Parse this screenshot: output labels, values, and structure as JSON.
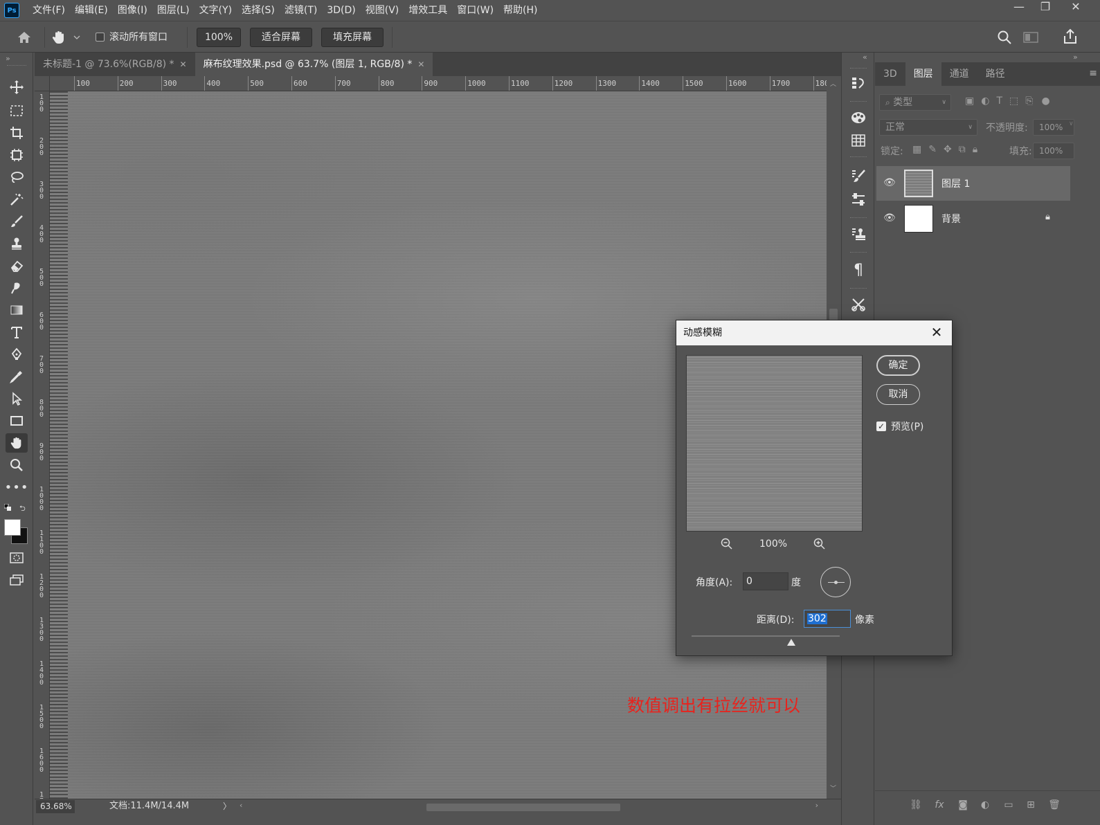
{
  "app": {
    "logo": "Ps"
  },
  "menu": [
    "文件(F)",
    "编辑(E)",
    "图像(I)",
    "图层(L)",
    "文字(Y)",
    "选择(S)",
    "滤镜(T)",
    "3D(D)",
    "视图(V)",
    "增效工具",
    "窗口(W)",
    "帮助(H)"
  ],
  "window_controls": {
    "minimize": "—",
    "restore": "❐",
    "close": "✕"
  },
  "options": {
    "scroll_all_label": "滚动所有窗口",
    "scroll_all_checked": false,
    "zoom_value": "100%",
    "fit_screen": "适合屏幕",
    "fill_screen": "填充屏幕"
  },
  "tabs": [
    {
      "label": "未标题-1 @ 73.6%(RGB/8) *",
      "active": false
    },
    {
      "label": "麻布纹理效果.psd @ 63.7% (图层 1, RGB/8) *",
      "active": true
    }
  ],
  "ruler_h": [
    "100",
    "200",
    "300",
    "400",
    "500",
    "600",
    "700",
    "800",
    "900",
    "1000",
    "1100",
    "1200",
    "1300",
    "1400",
    "1500",
    "1600",
    "1700",
    "180"
  ],
  "ruler_v": [
    "100",
    "200",
    "300",
    "400",
    "500",
    "600",
    "700",
    "800",
    "900",
    "1000",
    "1100",
    "1200",
    "1300",
    "1400",
    "1500",
    "1600",
    "17"
  ],
  "canvas": {
    "annotation": "数值调出有拉丝就可以",
    "annotation_color": "#e8231d"
  },
  "status": {
    "zoom": "63.68%",
    "doc_info": "文档:11.4M/14.4M",
    "arrow": "〉"
  },
  "icons": {
    "tools": [
      "move-icon",
      "marquee-icon",
      "crop-icon",
      "frame-icon",
      "lasso-icon",
      "magic-wand-icon",
      "brush-icon",
      "stamp-icon",
      "eraser-icon",
      "smudge-icon",
      "gradient-icon",
      "type-icon",
      "pen-icon",
      "eyedropper-icon",
      "path-select-icon",
      "rectangle-icon",
      "hand-icon",
      "zoom-icon",
      "more-icon"
    ],
    "strip": [
      "history-icon",
      "color-icon",
      "swatches-icon",
      "brushes-icon",
      "adjustments-icon",
      "clone-source-icon",
      "paragraph-icon",
      "tools-icon"
    ]
  },
  "layers_panel": {
    "tabs": [
      {
        "label": "3D",
        "active": false
      },
      {
        "label": "图层",
        "active": true
      },
      {
        "label": "通道",
        "active": false
      },
      {
        "label": "路径",
        "active": false
      }
    ],
    "filter_placeholder": "类型",
    "blend_mode": "正常",
    "opacity_label": "不透明度:",
    "opacity_value": "100%",
    "lock_label": "锁定:",
    "fill_label": "填充:",
    "fill_value": "100%",
    "layers": [
      {
        "name": "图层 1",
        "visible": true,
        "selected": true,
        "locked": false
      },
      {
        "name": "背景",
        "visible": true,
        "selected": false,
        "locked": true
      }
    ]
  },
  "dialog": {
    "title": "动感模糊",
    "ok": "确定",
    "cancel": "取消",
    "preview_label": "预览(P)",
    "preview_checked": true,
    "zoom_level": "100%",
    "angle_label": "角度(A):",
    "angle_value": "0",
    "angle_unit": "度",
    "distance_label": "距离(D):",
    "distance_value": "302",
    "distance_unit": "像素"
  }
}
